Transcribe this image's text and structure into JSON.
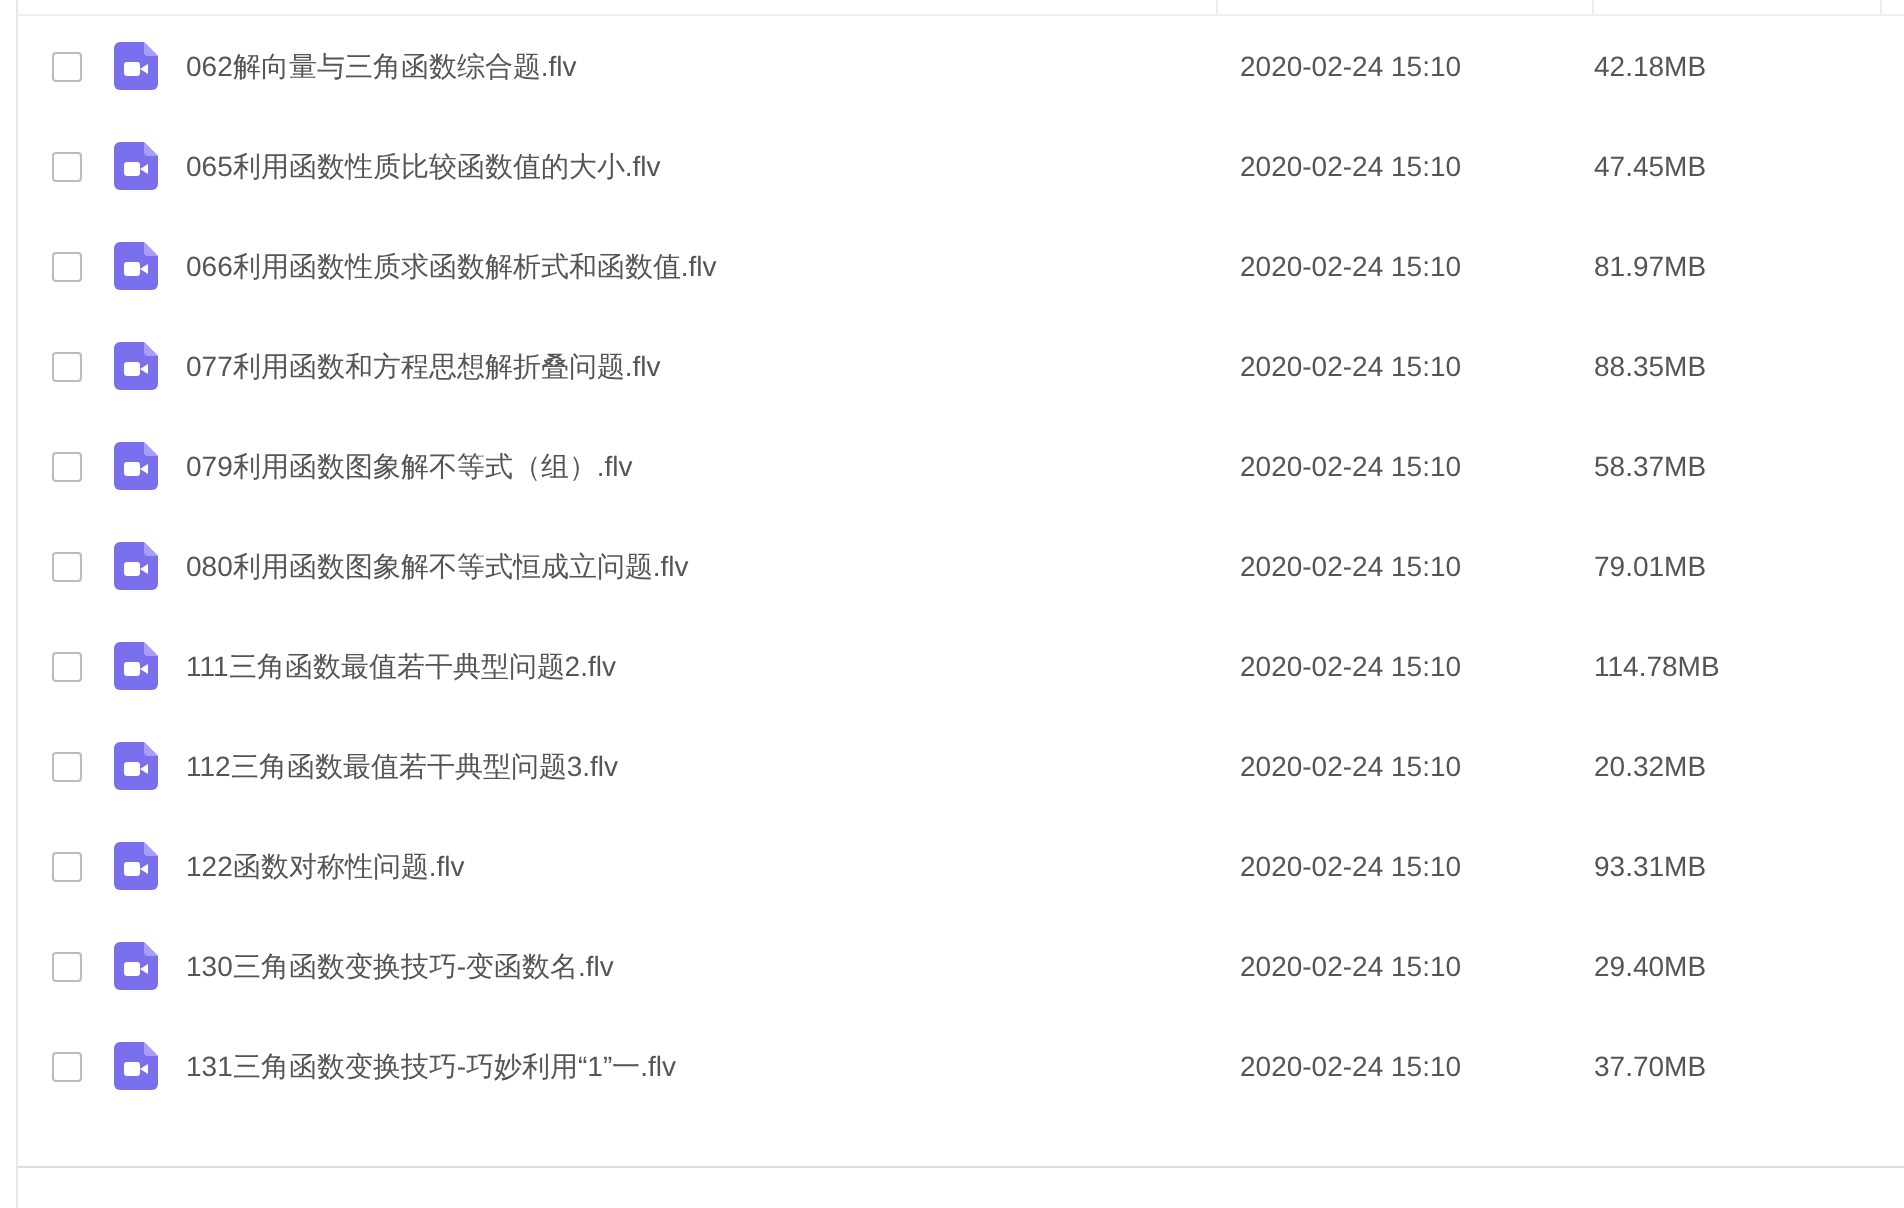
{
  "files": [
    {
      "name": "062解向量与三角函数综合题.flv",
      "modified": "2020-02-24 15:10",
      "size": "42.18MB",
      "checked": false
    },
    {
      "name": "065利用函数性质比较函数值的大小.flv",
      "modified": "2020-02-24 15:10",
      "size": "47.45MB",
      "checked": false
    },
    {
      "name": "066利用函数性质求函数解析式和函数值.flv",
      "modified": "2020-02-24 15:10",
      "size": "81.97MB",
      "checked": false
    },
    {
      "name": "077利用函数和方程思想解折叠问题.flv",
      "modified": "2020-02-24 15:10",
      "size": "88.35MB",
      "checked": false
    },
    {
      "name": "079利用函数图象解不等式（组）.flv",
      "modified": "2020-02-24 15:10",
      "size": "58.37MB",
      "checked": false
    },
    {
      "name": "080利用函数图象解不等式恒成立问题.flv",
      "modified": "2020-02-24 15:10",
      "size": "79.01MB",
      "checked": false
    },
    {
      "name": "111三角函数最值若干典型问题2.flv",
      "modified": "2020-02-24 15:10",
      "size": "114.78MB",
      "checked": false
    },
    {
      "name": "112三角函数最值若干典型问题3.flv",
      "modified": "2020-02-24 15:10",
      "size": "20.32MB",
      "checked": false
    },
    {
      "name": "122函数对称性问题.flv",
      "modified": "2020-02-24 15:10",
      "size": "93.31MB",
      "checked": false
    },
    {
      "name": "130三角函数变换技巧-变函数名.flv",
      "modified": "2020-02-24 15:10",
      "size": "29.40MB",
      "checked": false
    },
    {
      "name": "131三角函数变换技巧-巧妙利用“1”一.flv",
      "modified": "2020-02-24 15:10",
      "size": "37.70MB",
      "checked": false
    }
  ]
}
